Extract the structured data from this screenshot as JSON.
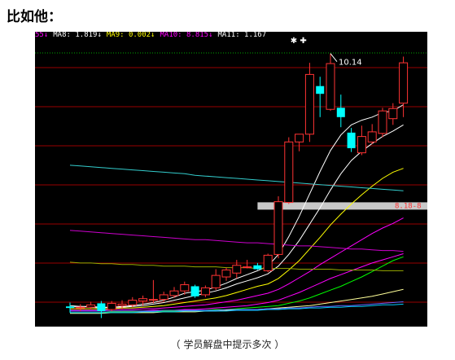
{
  "heading": "比如他：",
  "caption": "（ 学员解盘中提示多次 ）",
  "ma_legend": [
    {
      "text": "55↓",
      "color": "#ff00ff"
    },
    {
      "text": "MA8: 1.819↓",
      "color": "#ffffff"
    },
    {
      "text": "MA9: 0.002↓",
      "color": "#ffff00"
    },
    {
      "text": "MA10: 8.815↓",
      "color": "#ff00ff"
    },
    {
      "text": "MA11: 1.167",
      "color": "#ffffff"
    }
  ],
  "peak_label": "10.14",
  "price_tag": "8.18-8",
  "markers": "✱ ✚",
  "colors": {
    "up": "#ff3333",
    "down": "#00ffff",
    "background": "#000000",
    "grid": "#990000",
    "highlight_band": "#c8c8c8"
  },
  "chart_data": {
    "type": "candlestick",
    "candles": [
      {
        "o": 6.88,
        "h": 6.93,
        "l": 6.8,
        "c": 6.86
      },
      {
        "o": 6.86,
        "h": 6.91,
        "l": 6.82,
        "c": 6.87
      },
      {
        "o": 6.87,
        "h": 6.94,
        "l": 6.84,
        "c": 6.9
      },
      {
        "o": 6.92,
        "h": 6.95,
        "l": 6.73,
        "c": 6.82
      },
      {
        "o": 6.84,
        "h": 6.95,
        "l": 6.82,
        "c": 6.92
      },
      {
        "o": 6.89,
        "h": 6.96,
        "l": 6.84,
        "c": 6.91
      },
      {
        "o": 6.9,
        "h": 7.0,
        "l": 6.87,
        "c": 6.96
      },
      {
        "o": 6.95,
        "h": 7.02,
        "l": 6.89,
        "c": 6.98
      },
      {
        "o": 6.96,
        "h": 7.22,
        "l": 6.92,
        "c": 6.97
      },
      {
        "o": 6.97,
        "h": 7.07,
        "l": 6.94,
        "c": 7.03
      },
      {
        "o": 7.02,
        "h": 7.13,
        "l": 6.99,
        "c": 7.08
      },
      {
        "o": 7.08,
        "h": 7.2,
        "l": 7.03,
        "c": 7.16
      },
      {
        "o": 7.14,
        "h": 7.16,
        "l": 6.99,
        "c": 7.01
      },
      {
        "o": 7.03,
        "h": 7.15,
        "l": 7.0,
        "c": 7.12
      },
      {
        "o": 7.12,
        "h": 7.36,
        "l": 7.09,
        "c": 7.28
      },
      {
        "o": 7.26,
        "h": 7.38,
        "l": 7.21,
        "c": 7.35
      },
      {
        "o": 7.31,
        "h": 7.48,
        "l": 7.24,
        "c": 7.41
      },
      {
        "o": 7.39,
        "h": 7.48,
        "l": 7.37,
        "c": 7.39
      },
      {
        "o": 7.41,
        "h": 7.44,
        "l": 7.35,
        "c": 7.36
      },
      {
        "o": 7.34,
        "h": 7.56,
        "l": 7.32,
        "c": 7.54
      },
      {
        "o": 7.55,
        "h": 8.3,
        "l": 7.5,
        "c": 8.23
      },
      {
        "o": 8.22,
        "h": 9.06,
        "l": 8.2,
        "c": 9.0
      },
      {
        "o": 9.0,
        "h": 9.08,
        "l": 8.88,
        "c": 9.1
      },
      {
        "o": 9.1,
        "h": 10.02,
        "l": 9.0,
        "c": 9.87
      },
      {
        "o": 9.72,
        "h": 9.84,
        "l": 9.32,
        "c": 9.62
      },
      {
        "o": 9.42,
        "h": 10.14,
        "l": 9.4,
        "c": 10.01
      },
      {
        "o": 9.44,
        "h": 9.61,
        "l": 9.19,
        "c": 9.32
      },
      {
        "o": 9.12,
        "h": 9.18,
        "l": 8.87,
        "c": 8.92
      },
      {
        "o": 8.86,
        "h": 9.21,
        "l": 8.83,
        "c": 9.07
      },
      {
        "o": 9.0,
        "h": 9.23,
        "l": 8.97,
        "c": 9.13
      },
      {
        "o": 9.11,
        "h": 9.44,
        "l": 9.06,
        "c": 9.4
      },
      {
        "o": 9.3,
        "h": 9.5,
        "l": 9.22,
        "c": 9.43
      },
      {
        "o": 9.5,
        "h": 10.1,
        "l": 9.32,
        "c": 10.02
      }
    ],
    "ma_lines": [
      {
        "color": "#ffffff",
        "values": [
          6.89,
          6.88,
          6.87,
          6.86,
          6.87,
          6.88,
          6.89,
          6.91,
          6.93,
          6.96,
          7.0,
          7.05,
          7.07,
          7.09,
          7.13,
          7.18,
          7.24,
          7.29,
          7.34,
          7.4,
          7.55,
          7.78,
          8.04,
          8.33,
          8.62,
          8.89,
          9.09,
          9.22,
          9.28,
          9.32,
          9.38,
          9.4,
          9.48
        ]
      },
      {
        "color": "#ffffff",
        "values": [
          6.87,
          6.88,
          6.88,
          6.87,
          6.87,
          6.87,
          6.88,
          6.89,
          6.91,
          6.93,
          6.96,
          6.99,
          7.02,
          7.05,
          7.08,
          7.12,
          7.17,
          7.21,
          7.25,
          7.3,
          7.4,
          7.55,
          7.73,
          7.94,
          8.15,
          8.38,
          8.59,
          8.76,
          8.88,
          8.98,
          9.07,
          9.14,
          9.22
        ]
      },
      {
        "color": "#ffff00",
        "values": [
          6.85,
          6.85,
          6.85,
          6.85,
          6.85,
          6.86,
          6.86,
          6.87,
          6.88,
          6.89,
          6.91,
          6.93,
          6.95,
          6.97,
          6.99,
          7.02,
          7.06,
          7.1,
          7.14,
          7.17,
          7.24,
          7.35,
          7.47,
          7.62,
          7.77,
          7.93,
          8.07,
          8.2,
          8.32,
          8.43,
          8.53,
          8.61,
          8.66
        ]
      },
      {
        "color": "#ff00ff",
        "values": [
          6.83,
          6.83,
          6.83,
          6.83,
          6.84,
          6.84,
          6.84,
          6.85,
          6.85,
          6.86,
          6.87,
          6.88,
          6.89,
          6.9,
          6.92,
          6.94,
          6.96,
          6.99,
          7.02,
          7.05,
          7.1,
          7.17,
          7.25,
          7.33,
          7.42,
          7.5,
          7.58,
          7.66,
          7.74,
          7.82,
          7.89,
          7.95,
          8.02
        ]
      },
      {
        "color": "#ff00ff",
        "values": [
          6.82,
          6.82,
          6.82,
          6.82,
          6.82,
          6.82,
          6.82,
          6.82,
          6.83,
          6.83,
          6.83,
          6.84,
          6.84,
          6.85,
          6.86,
          6.87,
          6.88,
          6.89,
          6.91,
          6.93,
          6.96,
          7.01,
          7.06,
          7.12,
          7.18,
          7.24,
          7.29,
          7.34,
          7.39,
          7.44,
          7.48,
          7.52,
          7.56
        ]
      },
      {
        "color": "#00ff00",
        "values": [
          6.8,
          6.8,
          6.8,
          6.8,
          6.81,
          6.81,
          6.81,
          6.81,
          6.81,
          6.82,
          6.82,
          6.82,
          6.83,
          6.83,
          6.84,
          6.84,
          6.85,
          6.86,
          6.87,
          6.88,
          6.89,
          6.92,
          6.95,
          6.99,
          7.04,
          7.09,
          7.14,
          7.2,
          7.26,
          7.33,
          7.4,
          7.47,
          7.52
        ]
      },
      {
        "color": "#ffff99",
        "values": [
          6.79,
          6.79,
          6.79,
          6.79,
          6.8,
          6.8,
          6.8,
          6.8,
          6.8,
          6.81,
          6.81,
          6.81,
          6.81,
          6.82,
          6.82,
          6.83,
          6.83,
          6.84,
          6.84,
          6.85,
          6.86,
          6.87,
          6.88,
          6.89,
          6.91,
          6.93,
          6.95,
          6.97,
          6.99,
          7.01,
          7.04,
          7.07,
          7.1
        ]
      },
      {
        "color": "#6666ff",
        "values": [
          6.82,
          6.82,
          6.82,
          6.82,
          6.82,
          6.82,
          6.82,
          6.82,
          6.82,
          6.83,
          6.83,
          6.83,
          6.83,
          6.83,
          6.83,
          6.84,
          6.84,
          6.84,
          6.84,
          6.85,
          6.85,
          6.86,
          6.86,
          6.87,
          6.88,
          6.88,
          6.89,
          6.89,
          6.9,
          6.91,
          6.92,
          6.93,
          6.94
        ]
      },
      {
        "color": "#00ccff",
        "values": [
          6.8,
          6.8,
          6.8,
          6.8,
          6.8,
          6.8,
          6.8,
          6.81,
          6.81,
          6.81,
          6.81,
          6.82,
          6.82,
          6.82,
          6.82,
          6.82,
          6.83,
          6.83,
          6.83,
          6.84,
          6.84,
          6.85,
          6.85,
          6.86,
          6.86,
          6.87,
          6.87,
          6.88,
          6.88,
          6.89,
          6.9,
          6.9,
          6.91
        ]
      },
      {
        "color": "#33cccc",
        "values": [
          8.7,
          8.69,
          8.68,
          8.67,
          8.66,
          8.65,
          8.64,
          8.63,
          8.62,
          8.61,
          8.6,
          8.59,
          8.57,
          8.56,
          8.55,
          8.54,
          8.53,
          8.52,
          8.51,
          8.5,
          8.49,
          8.48,
          8.47,
          8.46,
          8.45,
          8.44,
          8.43,
          8.42,
          8.41,
          8.4,
          8.39,
          8.38,
          8.37
        ]
      },
      {
        "color": "#cc00cc",
        "values": [
          7.86,
          7.85,
          7.84,
          7.83,
          7.82,
          7.81,
          7.8,
          7.79,
          7.78,
          7.77,
          7.76,
          7.75,
          7.74,
          7.74,
          7.73,
          7.72,
          7.71,
          7.7,
          7.7,
          7.69,
          7.68,
          7.67,
          7.66,
          7.66,
          7.65,
          7.64,
          7.63,
          7.62,
          7.62,
          7.61,
          7.6,
          7.6,
          7.59
        ]
      },
      {
        "color": "#99aa00",
        "values": [
          7.45,
          7.44,
          7.44,
          7.43,
          7.43,
          7.42,
          7.42,
          7.41,
          7.41,
          7.4,
          7.4,
          7.4,
          7.39,
          7.39,
          7.39,
          7.38,
          7.38,
          7.38,
          7.37,
          7.37,
          7.37,
          7.37,
          7.36,
          7.36,
          7.36,
          7.36,
          7.35,
          7.35,
          7.35,
          7.35,
          7.34,
          7.34,
          7.34
        ]
      }
    ],
    "resistance_band": 8.18,
    "peak": 10.14,
    "ylim": [
      6.62,
      10.42
    ]
  }
}
